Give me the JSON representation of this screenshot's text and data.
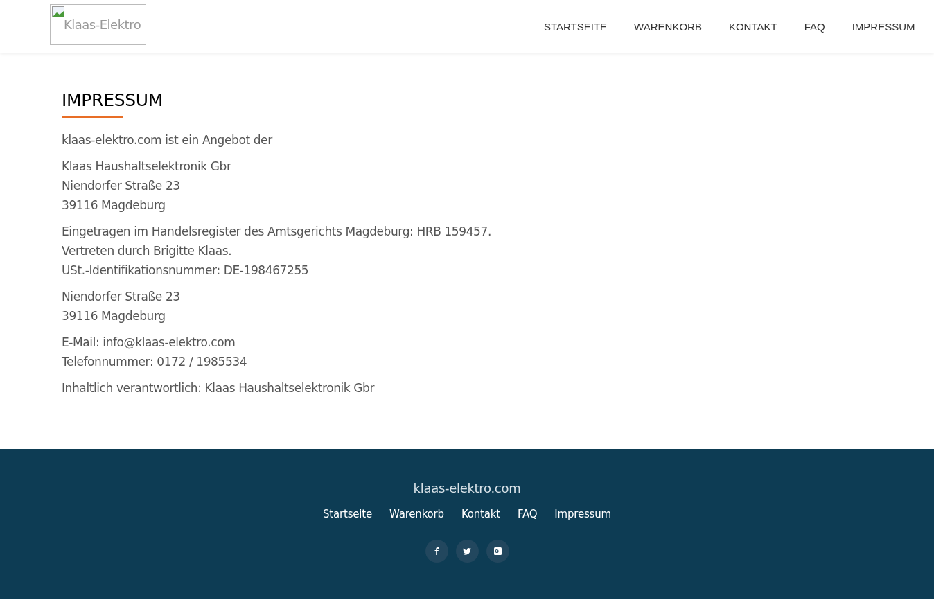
{
  "header": {
    "logo_alt": "Klaas-Elektro",
    "nav": [
      "STARTSEITE",
      "WARENKORB",
      "KONTAKT",
      "FAQ",
      "IMPRESSUM"
    ]
  },
  "content": {
    "title": "IMPRESSUM",
    "paragraphs": [
      [
        "klaas-elektro.com ist ein Angebot der"
      ],
      [
        "Klaas Haushaltselektronik Gbr",
        "Niendorfer Straße 23",
        "39116 Magdeburg"
      ],
      [
        "Eingetragen im Handelsregister des Amtsgerichts Magdeburg: HRB 159457.",
        "Vertreten durch Brigitte Klaas.",
        "USt.-Identifikationsnummer: DE-198467255"
      ],
      [
        "Niendorfer Straße 23",
        "39116 Magdeburg"
      ],
      [
        "E-Mail: info@klaas-elektro.com",
        "Telefonnummer: 0172 / 1985534"
      ],
      [
        "Inhaltlich verantwortlich: Klaas Haushaltselektronik Gbr"
      ]
    ]
  },
  "footer": {
    "site": "klaas-elektro.com",
    "links": [
      "Startseite",
      "Warenkorb",
      "Kontakt",
      "FAQ",
      "Impressum"
    ],
    "social": [
      {
        "kind": "facebook"
      },
      {
        "kind": "twitter"
      },
      {
        "kind": "google-plus"
      }
    ]
  }
}
